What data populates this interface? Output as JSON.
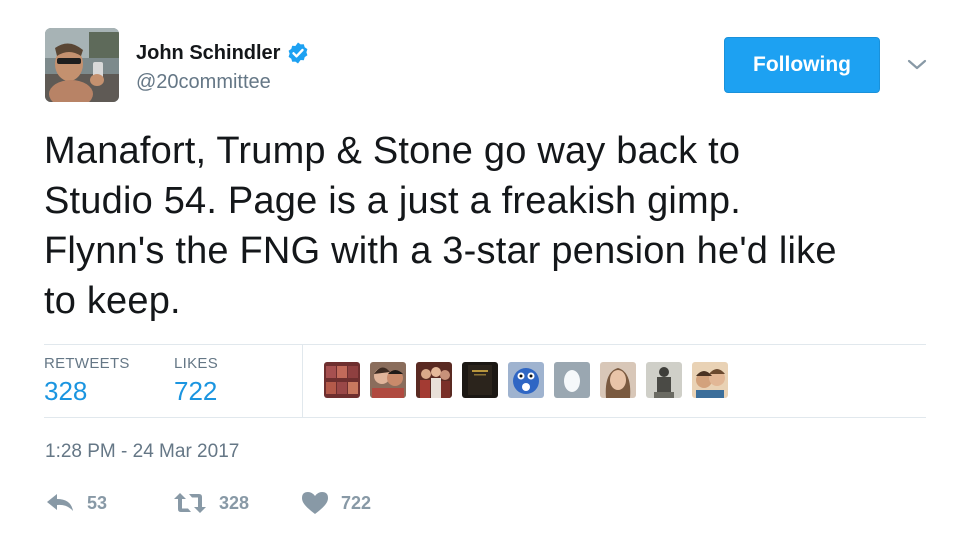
{
  "author": {
    "display_name": "John Schindler",
    "handle": "@20committee",
    "verified_icon": "verified-badge-icon"
  },
  "follow_button": {
    "label": "Following"
  },
  "menu_icon": "chevron-down-icon",
  "tweet": {
    "text_lines": [
      "Manafort, Trump & Stone go way back to",
      "Studio 54. Page is a just a freakish gimp.",
      "Flynn's the FNG with a 3-star pension he'd like",
      "to keep."
    ],
    "timestamp": "1:28 PM - 24 Mar 2017"
  },
  "stats": {
    "retweets_label": "RETWEETS",
    "retweets_value": "328",
    "likes_label": "LIKES",
    "likes_value": "722"
  },
  "likers": [
    {
      "icon": "liker-avatar-group-icon",
      "color": "#8b3a3a"
    },
    {
      "icon": "liker-avatar-couple-icon",
      "color": "#c98a6b"
    },
    {
      "icon": "liker-avatar-family-icon",
      "color": "#7a3b2e"
    },
    {
      "icon": "liker-avatar-book-icon",
      "color": "#2b241c"
    },
    {
      "icon": "liker-avatar-mascot-icon",
      "color": "#2f66c4"
    },
    {
      "icon": "liker-avatar-egg-icon",
      "color": "#9aa7b1"
    },
    {
      "icon": "liker-avatar-woman-icon",
      "color": "#b48a70"
    },
    {
      "icon": "liker-avatar-statue-icon",
      "color": "#5b5b55"
    },
    {
      "icon": "liker-avatar-selfie-icon",
      "color": "#d3a27c"
    }
  ],
  "actions": {
    "reply_count": "53",
    "retweet_count": "328",
    "like_count": "722"
  },
  "colors": {
    "accent": "#1da1f2",
    "link_blue": "#1b95e0",
    "muted_text": "#657786",
    "action_gray": "#8899a6",
    "border": "#e1e8ed"
  }
}
